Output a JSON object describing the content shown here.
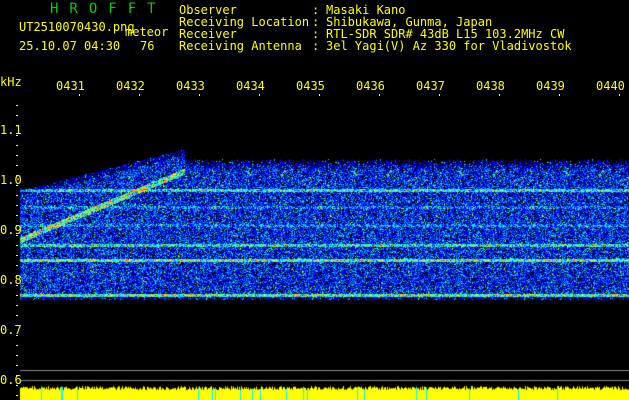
{
  "header": {
    "logo": "HROFFT",
    "filename": "UT2510070430.png",
    "mode": "meteor",
    "datetime": "25.10.07 04:30",
    "count": "76",
    "info": [
      {
        "label": "Observer",
        "value": "Masaki Kano"
      },
      {
        "label": "Receiving Location",
        "value": "Shibukawa, Gunma, Japan"
      },
      {
        "label": "Receiver",
        "value": "RTL-SDR SDR# 43dB L15 103.2MHz CW"
      },
      {
        "label": "Receiving Antenna",
        "value": "3el Yagi(V) Az 330 for Vladivostok"
      }
    ]
  },
  "axes": {
    "y_unit": "kHz",
    "y_ticks": [
      "1.1",
      "1.0",
      "0.9",
      "0.8",
      "0.7",
      "0.6"
    ],
    "x_ticks": [
      "0431",
      "0432",
      "0433",
      "0434",
      "0435",
      "0436",
      "0437",
      "0438",
      "0439",
      "0440"
    ]
  },
  "colors": {
    "text": "#ffff00",
    "logo": "#00d000",
    "background": "#000000"
  }
}
